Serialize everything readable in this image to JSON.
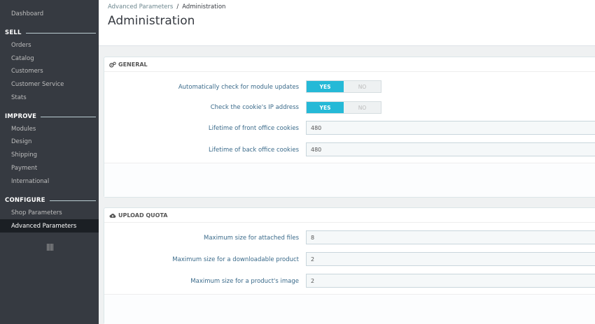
{
  "sidebar": {
    "dashboard": "Dashboard",
    "sections": [
      {
        "label": "SELL",
        "items": [
          "Orders",
          "Catalog",
          "Customers",
          "Customer Service",
          "Stats"
        ]
      },
      {
        "label": "IMPROVE",
        "items": [
          "Modules",
          "Design",
          "Shipping",
          "Payment",
          "International"
        ]
      },
      {
        "label": "CONFIGURE",
        "items": [
          "Shop Parameters",
          "Advanced Parameters"
        ]
      }
    ],
    "active_item": "Advanced Parameters",
    "collapse_icon": "bars-icon"
  },
  "header": {
    "breadcrumb": [
      "Advanced Parameters",
      "Administration"
    ],
    "separator": "/",
    "title": "Administration"
  },
  "general": {
    "heading": "GENERAL",
    "icon": "cogs-icon",
    "rows": [
      {
        "label": "Automatically check for module updates",
        "type": "switch",
        "on": "YES",
        "off": "NO",
        "value": "YES"
      },
      {
        "label": "Check the cookie's IP address",
        "type": "switch",
        "on": "YES",
        "off": "NO",
        "value": "YES"
      },
      {
        "label": "Lifetime of front office cookies",
        "type": "input",
        "value": "480"
      },
      {
        "label": "Lifetime of back office cookies",
        "type": "input",
        "value": "480"
      }
    ]
  },
  "upload": {
    "heading": "UPLOAD QUOTA",
    "icon": "cloud-upload-icon",
    "rows": [
      {
        "label": "Maximum size for attached files",
        "value": "8"
      },
      {
        "label": "Maximum size for a downloadable product",
        "value": "2"
      },
      {
        "label": "Maximum size for a product's image",
        "value": "2"
      }
    ]
  },
  "colors": {
    "sidebar_bg": "#363a41",
    "accent": "#25b9d7",
    "label_text": "#3a6a8a"
  }
}
